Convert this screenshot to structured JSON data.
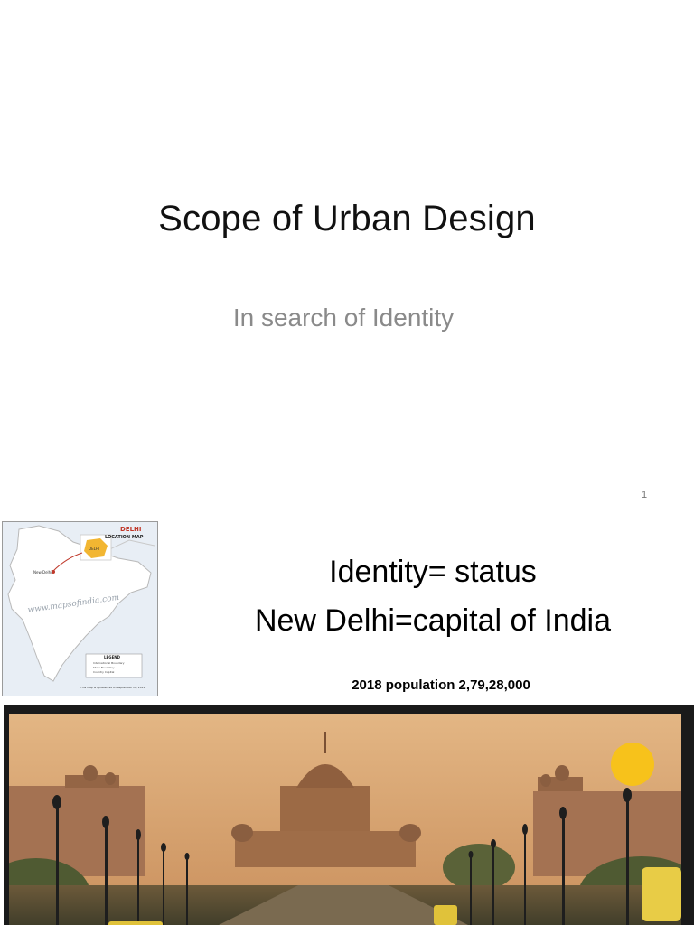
{
  "slide1": {
    "title": "Scope of Urban Design",
    "subtitle": "In search of Identity",
    "page_number": "1"
  },
  "slide2": {
    "map": {
      "title": "DELHI",
      "subtitle": "LOCATION MAP",
      "watermark": "www.mapsofindia.com",
      "city_label": "New Delhi",
      "inset_label": "DELHI",
      "legend_title": "LEGEND",
      "legend_items": [
        "International Boundary",
        "State Boundary",
        "Country Capital"
      ],
      "footer": "This map is updated as on September 10, 2011",
      "colors": {
        "sea": "#e8eef5",
        "land": "#ffffff",
        "delhi": "#f2b632",
        "marker": "#c0392b"
      }
    },
    "heading_line1": "Identity= status",
    "heading_line2": "New Delhi=capital of India",
    "population": "2018 population 2,79,28,000",
    "photo": {
      "description_icon": "rashtrapati-bhavan-photo",
      "colors": {
        "sky": "#d9a873",
        "sun": "#f7c21b",
        "building": "#9c6a45"
      }
    }
  }
}
